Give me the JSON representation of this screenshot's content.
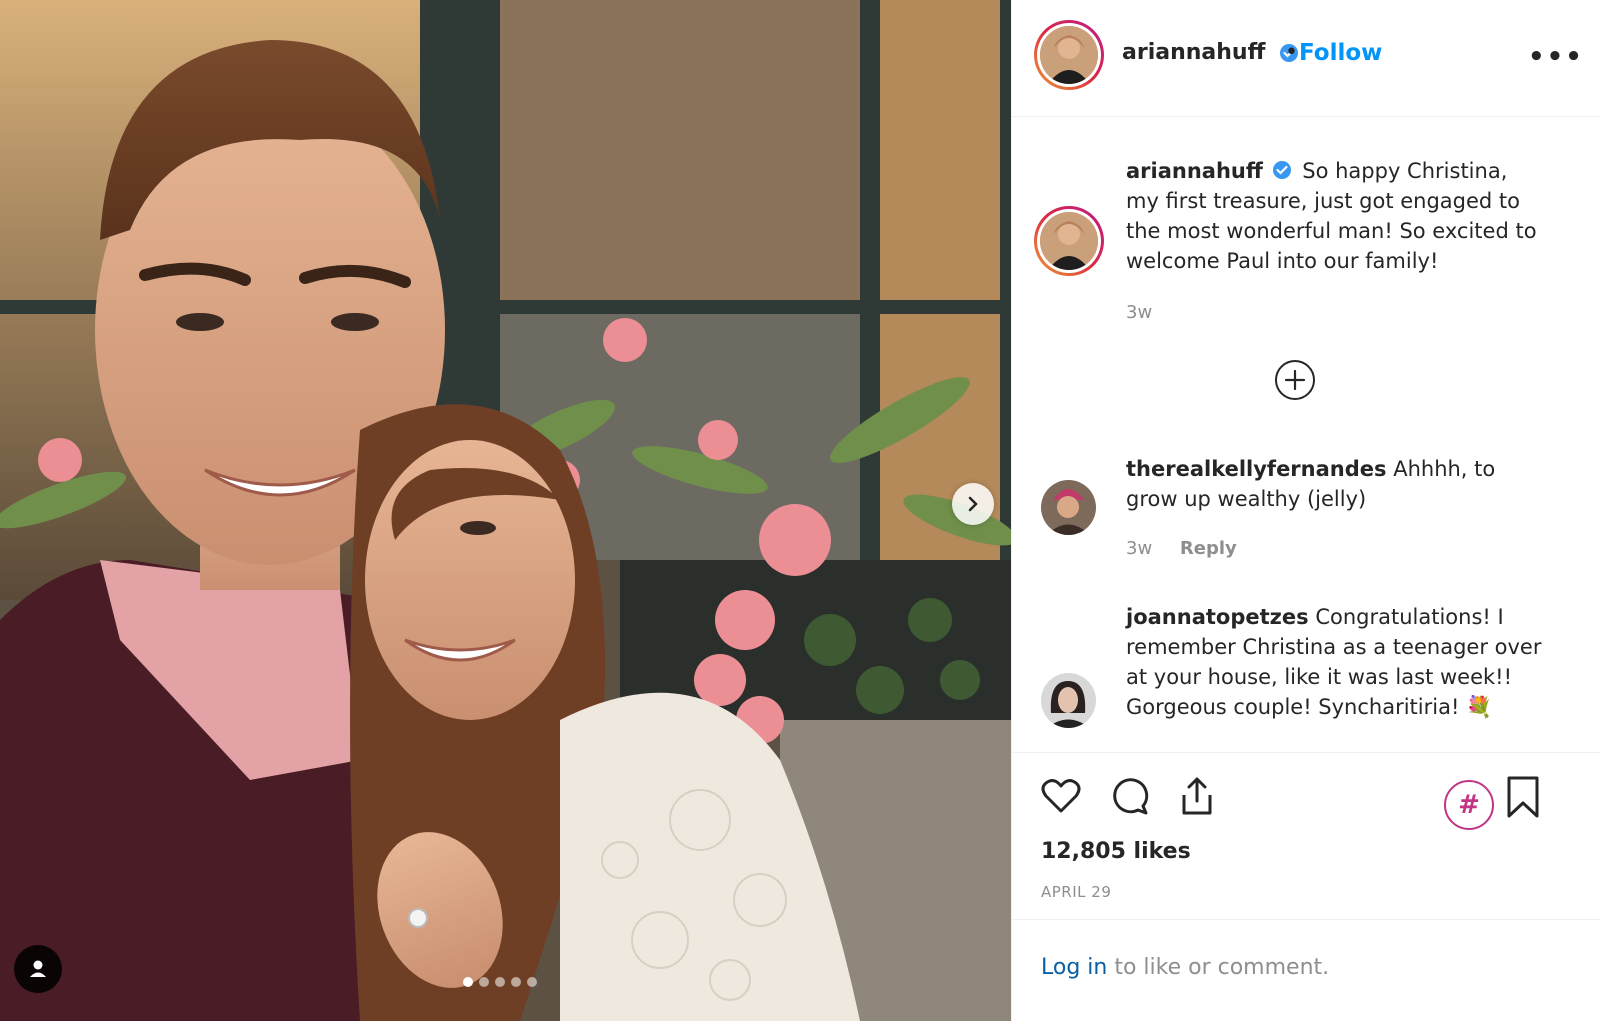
{
  "post": {
    "image_alt": "Selfie of a smiling couple in front of a window box with pink tulips",
    "carousel_dots": 5,
    "active_dot": 0
  },
  "header": {
    "username": "ariannahuff",
    "separator": "•",
    "follow_label": "Follow",
    "more_label": "•••"
  },
  "caption": {
    "username": "ariannahuff",
    "text": "So happy Christina, my first treasure, just got engaged to the most wonderful man! So excited to welcome Paul into our family!",
    "time": "3w"
  },
  "comments": [
    {
      "username": "therealkellyfernandes",
      "text": "Ahhhh, to grow up wealthy (jelly)",
      "time": "3w",
      "reply_label": "Reply"
    },
    {
      "username": "joannatopetzes",
      "text": "Congratulations! I remember Christina as a teenager over at your house, like it was last week!! Gorgeous couple! Syncharitiria!",
      "emoji": "💐"
    }
  ],
  "actions": {
    "icons": [
      "heart-icon",
      "comment-icon",
      "share-icon",
      "hashtag-icon",
      "bookmark-icon"
    ],
    "hashtag_symbol": "#",
    "likes": "12,805 likes",
    "date": "APRIL 29"
  },
  "login": {
    "link": "Log in",
    "rest": " to like or comment."
  },
  "colors": {
    "link_blue": "#0095f6",
    "text": "#262626",
    "muted": "#8e8e8e",
    "hashtag": "#c13584"
  }
}
